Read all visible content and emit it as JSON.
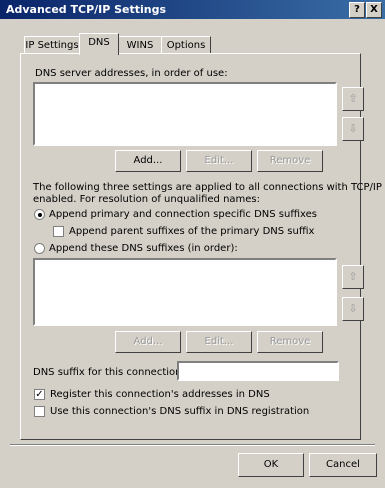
{
  "window": {
    "title": "Advanced TCP/IP Settings",
    "help_glyph": "?",
    "close_glyph": "X"
  },
  "tabs": [
    {
      "label": "IP Settings",
      "active": false
    },
    {
      "label": "DNS",
      "active": true
    },
    {
      "label": "WINS",
      "active": false
    },
    {
      "label": "Options",
      "active": false
    }
  ],
  "dns_servers": {
    "label": "DNS server addresses, in order of use:",
    "items": [],
    "up_glyph": "⇧",
    "down_glyph": "⇩",
    "buttons": {
      "add": "Add...",
      "edit": "Edit...",
      "remove": "Remove"
    }
  },
  "info_text_line1": "The following three settings are applied to all connections with TCP/IP",
  "info_text_line2": "enabled. For resolution of unqualified names:",
  "options": {
    "append_primary": {
      "label": "Append primary and connection specific DNS suffixes",
      "selected": true
    },
    "append_parent": {
      "label": "Append parent suffixes of the primary DNS suffix",
      "checked": false
    },
    "append_these": {
      "label": "Append these DNS suffixes (in order):",
      "selected": false
    }
  },
  "dns_suffixes": {
    "items": [],
    "up_glyph": "⇧",
    "down_glyph": "⇩",
    "buttons": {
      "add": "Add...",
      "edit": "Edit...",
      "remove": "Remove"
    }
  },
  "connection_suffix": {
    "label": "DNS suffix for this connection:",
    "value": ""
  },
  "register_addresses": {
    "label": "Register this connection's addresses in DNS",
    "checked": true
  },
  "use_suffix_registration": {
    "label": "Use this connection's DNS suffix in DNS registration",
    "checked": false
  },
  "footer": {
    "ok": "OK",
    "cancel": "Cancel"
  },
  "colors": {
    "title_start": "#0a246a",
    "title_end": "#3a6ea5",
    "dialog_bg": "#d4d0c8"
  }
}
